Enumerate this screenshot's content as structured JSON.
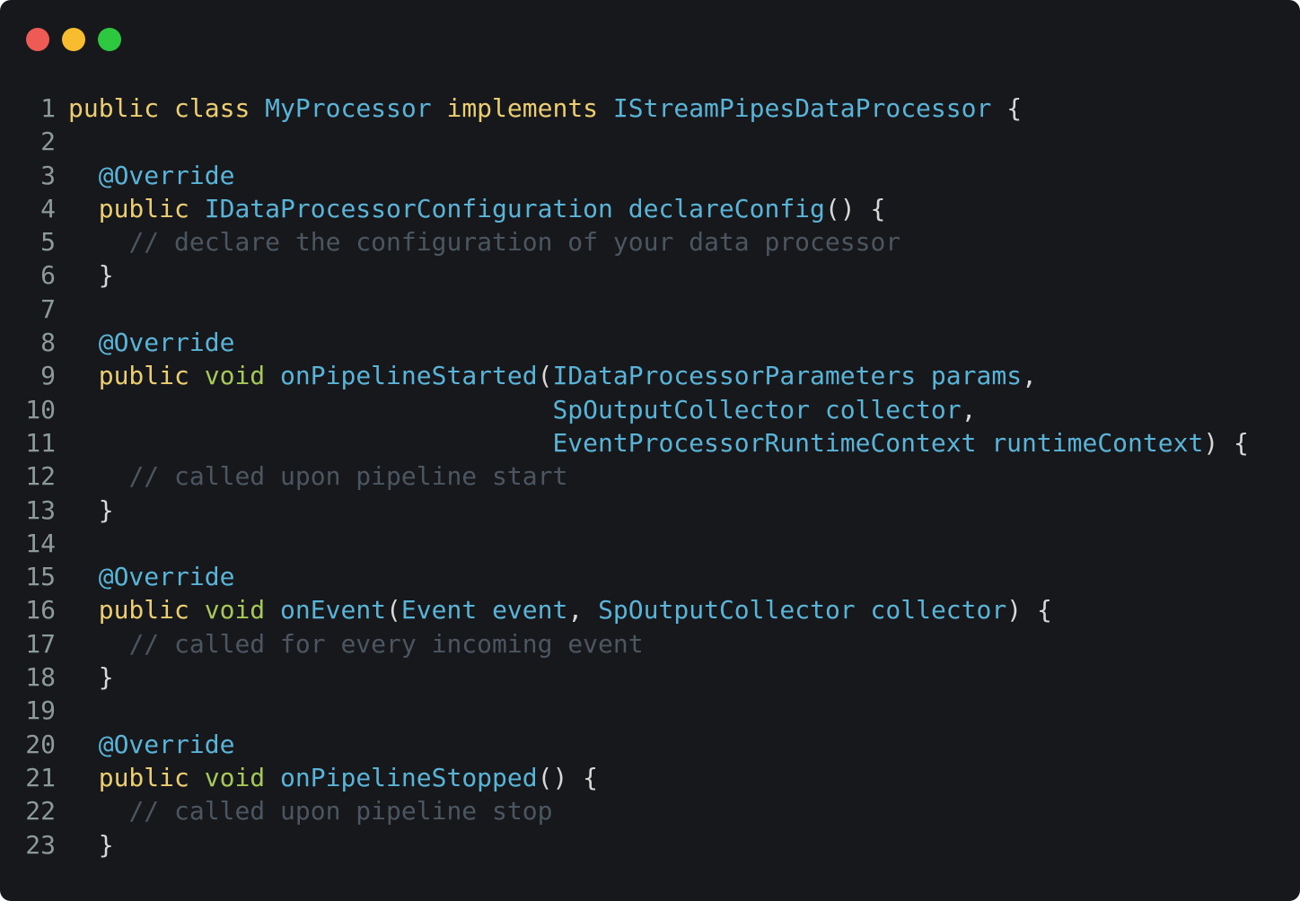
{
  "window": {
    "buttons": [
      {
        "name": "close",
        "color": "#ee5b55"
      },
      {
        "name": "minimize",
        "color": "#f7bd2f"
      },
      {
        "name": "maximize",
        "color": "#2ec840"
      }
    ]
  },
  "code": {
    "lines": [
      {
        "n": "1",
        "tokens": [
          [
            "kw",
            "public"
          ],
          [
            "pn",
            " "
          ],
          [
            "kw",
            "class"
          ],
          [
            "pn",
            " "
          ],
          [
            "ty",
            "MyProcessor"
          ],
          [
            "pn",
            " "
          ],
          [
            "kw",
            "implements"
          ],
          [
            "pn",
            " "
          ],
          [
            "ty",
            "IStreamPipesDataProcessor"
          ],
          [
            "pn",
            " {"
          ]
        ]
      },
      {
        "n": "2",
        "tokens": []
      },
      {
        "n": "3",
        "tokens": [
          [
            "pn",
            "  "
          ],
          [
            "an",
            "@Override"
          ]
        ]
      },
      {
        "n": "4",
        "tokens": [
          [
            "pn",
            "  "
          ],
          [
            "kw",
            "public"
          ],
          [
            "pn",
            " "
          ],
          [
            "ty",
            "IDataProcessorConfiguration"
          ],
          [
            "pn",
            " "
          ],
          [
            "fn",
            "declareConfig"
          ],
          [
            "pn",
            "() {"
          ]
        ]
      },
      {
        "n": "5",
        "tokens": [
          [
            "pn",
            "    "
          ],
          [
            "cm",
            "// declare the configuration of your data processor"
          ]
        ]
      },
      {
        "n": "6",
        "tokens": [
          [
            "pn",
            "  }"
          ]
        ]
      },
      {
        "n": "7",
        "tokens": []
      },
      {
        "n": "8",
        "tokens": [
          [
            "pn",
            "  "
          ],
          [
            "an",
            "@Override"
          ]
        ]
      },
      {
        "n": "9",
        "tokens": [
          [
            "pn",
            "  "
          ],
          [
            "kw",
            "public"
          ],
          [
            "pn",
            " "
          ],
          [
            "kw2",
            "void"
          ],
          [
            "pn",
            " "
          ],
          [
            "fn",
            "onPipelineStarted"
          ],
          [
            "pn",
            "("
          ],
          [
            "ty",
            "IDataProcessorParameters"
          ],
          [
            "pn",
            " "
          ],
          [
            "id",
            "params"
          ],
          [
            "pn",
            ","
          ]
        ]
      },
      {
        "n": "10",
        "tokens": [
          [
            "pn",
            "                                "
          ],
          [
            "ty",
            "SpOutputCollector"
          ],
          [
            "pn",
            " "
          ],
          [
            "id",
            "collector"
          ],
          [
            "pn",
            ","
          ]
        ]
      },
      {
        "n": "11",
        "tokens": [
          [
            "pn",
            "                                "
          ],
          [
            "ty",
            "EventProcessorRuntimeContext"
          ],
          [
            "pn",
            " "
          ],
          [
            "id",
            "runtimeContext"
          ],
          [
            "pn",
            ") {"
          ]
        ]
      },
      {
        "n": "12",
        "tokens": [
          [
            "pn",
            "    "
          ],
          [
            "cm",
            "// called upon pipeline start"
          ]
        ]
      },
      {
        "n": "13",
        "tokens": [
          [
            "pn",
            "  }"
          ]
        ]
      },
      {
        "n": "14",
        "tokens": []
      },
      {
        "n": "15",
        "tokens": [
          [
            "pn",
            "  "
          ],
          [
            "an",
            "@Override"
          ]
        ]
      },
      {
        "n": "16",
        "tokens": [
          [
            "pn",
            "  "
          ],
          [
            "kw",
            "public"
          ],
          [
            "pn",
            " "
          ],
          [
            "kw2",
            "void"
          ],
          [
            "pn",
            " "
          ],
          [
            "fn",
            "onEvent"
          ],
          [
            "pn",
            "("
          ],
          [
            "ty",
            "Event"
          ],
          [
            "pn",
            " "
          ],
          [
            "id",
            "event"
          ],
          [
            "pn",
            ", "
          ],
          [
            "ty",
            "SpOutputCollector"
          ],
          [
            "pn",
            " "
          ],
          [
            "id",
            "collector"
          ],
          [
            "pn",
            ") {"
          ]
        ]
      },
      {
        "n": "17",
        "tokens": [
          [
            "pn",
            "    "
          ],
          [
            "cm",
            "// called for every incoming event"
          ]
        ]
      },
      {
        "n": "18",
        "tokens": [
          [
            "pn",
            "  }"
          ]
        ]
      },
      {
        "n": "19",
        "tokens": []
      },
      {
        "n": "20",
        "tokens": [
          [
            "pn",
            "  "
          ],
          [
            "an",
            "@Override"
          ]
        ]
      },
      {
        "n": "21",
        "tokens": [
          [
            "pn",
            "  "
          ],
          [
            "kw",
            "public"
          ],
          [
            "pn",
            " "
          ],
          [
            "kw2",
            "void"
          ],
          [
            "pn",
            " "
          ],
          [
            "fn",
            "onPipelineStopped"
          ],
          [
            "pn",
            "() {"
          ]
        ]
      },
      {
        "n": "22",
        "tokens": [
          [
            "pn",
            "    "
          ],
          [
            "cm",
            "// called upon pipeline stop"
          ]
        ]
      },
      {
        "n": "23",
        "tokens": [
          [
            "pn",
            "  }"
          ]
        ]
      }
    ]
  }
}
